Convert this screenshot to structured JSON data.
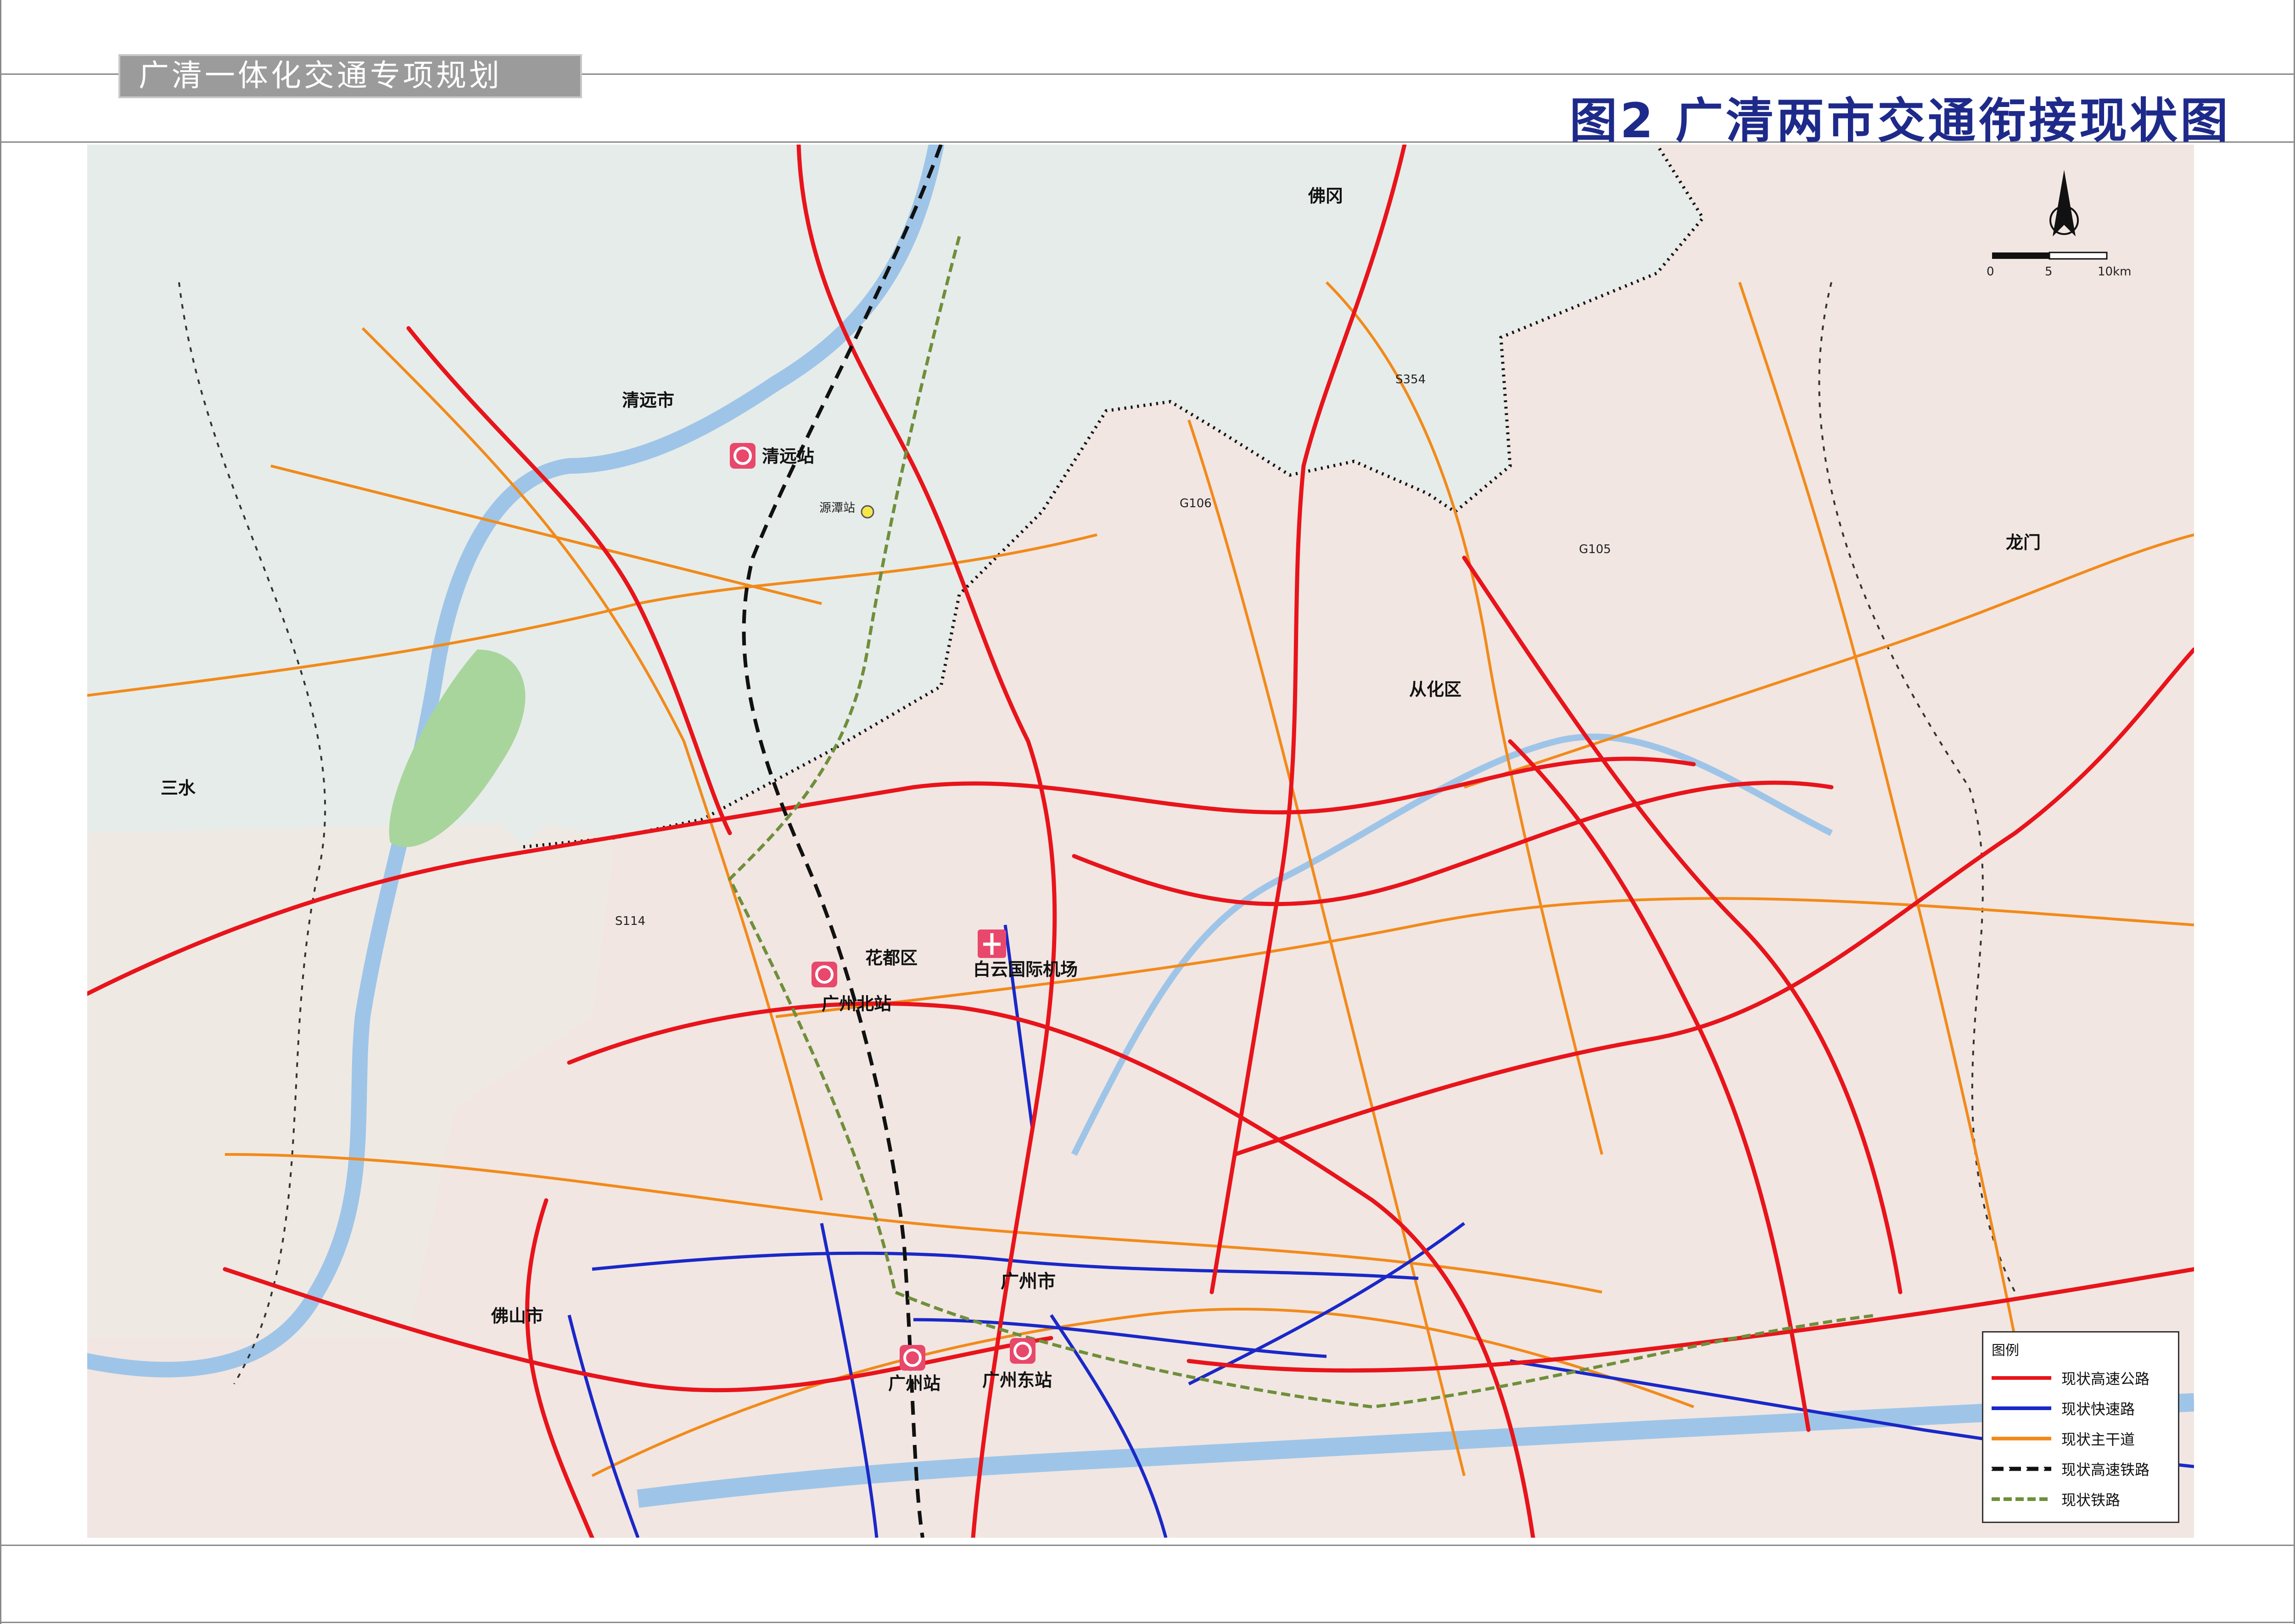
{
  "header": {
    "plan_name": "广清一体化交通专项规划",
    "map_title": "图2  广清两市交通衔接现状图"
  },
  "scale_bar": {
    "ticks": [
      "0",
      "5",
      "10km"
    ]
  },
  "places": {
    "qingyuan_city": "清远市",
    "foshan_north": "佛冈",
    "longmen": "龙门",
    "sanshui": "三水",
    "conghua": "从化区",
    "huadu": "花都区",
    "guangzhou_city": "广州市",
    "foshan_city": "佛山市"
  },
  "stations": {
    "qingyuan_station": "清远站",
    "yuantan_station": "源潭站",
    "guangzhou_north": "广州北站",
    "baiyun_airport": "白云国际机场",
    "guangzhou_station": "广州站",
    "guangzhou_east": "广州东站"
  },
  "road_labels": {
    "s354": "S354",
    "g106": "G106",
    "g105": "G105",
    "s114": "S114"
  },
  "legend": {
    "title": "图例",
    "items": [
      {
        "label": "现状高速公路",
        "color": "#e8141b",
        "style": "solid"
      },
      {
        "label": "现状快速路",
        "color": "#1a28c8",
        "style": "solid"
      },
      {
        "label": "现状主干道",
        "color": "#f28a1a",
        "style": "solid"
      },
      {
        "label": "现状高速铁路",
        "color": "#111111",
        "style": "hsr"
      },
      {
        "label": "现状铁路",
        "color": "#6f8f3a",
        "style": "rail"
      }
    ]
  },
  "colors": {
    "qingyuan_region": "#e6ecea",
    "guangzhou_region": "#f1e6e2",
    "river": "#9ec5e8",
    "expressway": "#e8141b",
    "express_road": "#1a28c8",
    "arterial": "#f28a1a",
    "boundary": "#111111",
    "title_blue": "#1e2a8a"
  }
}
